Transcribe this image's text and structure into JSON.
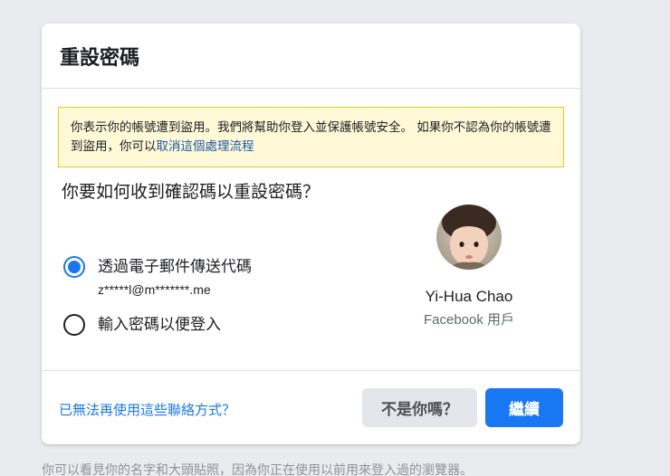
{
  "card": {
    "title": "重設密碼"
  },
  "notice": {
    "text": "你表示你的帳號遭到盜用。我們將幫助你登入並保護帳號安全。 如果你不認為你的帳號遭到盜用，你可以",
    "link": "取消這個處理流程"
  },
  "question": "你要如何收到確認碼以重設密碼？",
  "options": [
    {
      "label": "透過電子郵件傳送代碼",
      "sub": "z*****l@m*******.me",
      "selected": true
    },
    {
      "label": "輸入密碼以便登入",
      "selected": false
    }
  ],
  "profile": {
    "name": "Yi-Hua Chao",
    "subtitle": "Facebook 用戶"
  },
  "footer": {
    "link": "已無法再使用這些聯絡方式？",
    "not_you_label": "不是你嗎？",
    "continue_label": "繼續"
  },
  "below_text": "你可以看見你的名字和大頭貼照，因為你正在使用以前用來登入過的瀏覽器。",
  "colors": {
    "accent": "#1877f2",
    "notice_bg": "#fff9d7",
    "notice_border": "#e2c822"
  }
}
